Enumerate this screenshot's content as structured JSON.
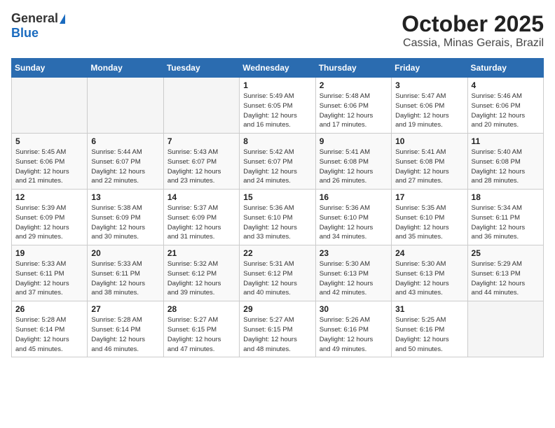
{
  "logo": {
    "general": "General",
    "blue": "Blue"
  },
  "header": {
    "month": "October 2025",
    "location": "Cassia, Minas Gerais, Brazil"
  },
  "weekdays": [
    "Sunday",
    "Monday",
    "Tuesday",
    "Wednesday",
    "Thursday",
    "Friday",
    "Saturday"
  ],
  "weeks": [
    [
      {
        "day": "",
        "info": ""
      },
      {
        "day": "",
        "info": ""
      },
      {
        "day": "",
        "info": ""
      },
      {
        "day": "1",
        "info": "Sunrise: 5:49 AM\nSunset: 6:05 PM\nDaylight: 12 hours\nand 16 minutes."
      },
      {
        "day": "2",
        "info": "Sunrise: 5:48 AM\nSunset: 6:06 PM\nDaylight: 12 hours\nand 17 minutes."
      },
      {
        "day": "3",
        "info": "Sunrise: 5:47 AM\nSunset: 6:06 PM\nDaylight: 12 hours\nand 19 minutes."
      },
      {
        "day": "4",
        "info": "Sunrise: 5:46 AM\nSunset: 6:06 PM\nDaylight: 12 hours\nand 20 minutes."
      }
    ],
    [
      {
        "day": "5",
        "info": "Sunrise: 5:45 AM\nSunset: 6:06 PM\nDaylight: 12 hours\nand 21 minutes."
      },
      {
        "day": "6",
        "info": "Sunrise: 5:44 AM\nSunset: 6:07 PM\nDaylight: 12 hours\nand 22 minutes."
      },
      {
        "day": "7",
        "info": "Sunrise: 5:43 AM\nSunset: 6:07 PM\nDaylight: 12 hours\nand 23 minutes."
      },
      {
        "day": "8",
        "info": "Sunrise: 5:42 AM\nSunset: 6:07 PM\nDaylight: 12 hours\nand 24 minutes."
      },
      {
        "day": "9",
        "info": "Sunrise: 5:41 AM\nSunset: 6:08 PM\nDaylight: 12 hours\nand 26 minutes."
      },
      {
        "day": "10",
        "info": "Sunrise: 5:41 AM\nSunset: 6:08 PM\nDaylight: 12 hours\nand 27 minutes."
      },
      {
        "day": "11",
        "info": "Sunrise: 5:40 AM\nSunset: 6:08 PM\nDaylight: 12 hours\nand 28 minutes."
      }
    ],
    [
      {
        "day": "12",
        "info": "Sunrise: 5:39 AM\nSunset: 6:09 PM\nDaylight: 12 hours\nand 29 minutes."
      },
      {
        "day": "13",
        "info": "Sunrise: 5:38 AM\nSunset: 6:09 PM\nDaylight: 12 hours\nand 30 minutes."
      },
      {
        "day": "14",
        "info": "Sunrise: 5:37 AM\nSunset: 6:09 PM\nDaylight: 12 hours\nand 31 minutes."
      },
      {
        "day": "15",
        "info": "Sunrise: 5:36 AM\nSunset: 6:10 PM\nDaylight: 12 hours\nand 33 minutes."
      },
      {
        "day": "16",
        "info": "Sunrise: 5:36 AM\nSunset: 6:10 PM\nDaylight: 12 hours\nand 34 minutes."
      },
      {
        "day": "17",
        "info": "Sunrise: 5:35 AM\nSunset: 6:10 PM\nDaylight: 12 hours\nand 35 minutes."
      },
      {
        "day": "18",
        "info": "Sunrise: 5:34 AM\nSunset: 6:11 PM\nDaylight: 12 hours\nand 36 minutes."
      }
    ],
    [
      {
        "day": "19",
        "info": "Sunrise: 5:33 AM\nSunset: 6:11 PM\nDaylight: 12 hours\nand 37 minutes."
      },
      {
        "day": "20",
        "info": "Sunrise: 5:33 AM\nSunset: 6:11 PM\nDaylight: 12 hours\nand 38 minutes."
      },
      {
        "day": "21",
        "info": "Sunrise: 5:32 AM\nSunset: 6:12 PM\nDaylight: 12 hours\nand 39 minutes."
      },
      {
        "day": "22",
        "info": "Sunrise: 5:31 AM\nSunset: 6:12 PM\nDaylight: 12 hours\nand 40 minutes."
      },
      {
        "day": "23",
        "info": "Sunrise: 5:30 AM\nSunset: 6:13 PM\nDaylight: 12 hours\nand 42 minutes."
      },
      {
        "day": "24",
        "info": "Sunrise: 5:30 AM\nSunset: 6:13 PM\nDaylight: 12 hours\nand 43 minutes."
      },
      {
        "day": "25",
        "info": "Sunrise: 5:29 AM\nSunset: 6:13 PM\nDaylight: 12 hours\nand 44 minutes."
      }
    ],
    [
      {
        "day": "26",
        "info": "Sunrise: 5:28 AM\nSunset: 6:14 PM\nDaylight: 12 hours\nand 45 minutes."
      },
      {
        "day": "27",
        "info": "Sunrise: 5:28 AM\nSunset: 6:14 PM\nDaylight: 12 hours\nand 46 minutes."
      },
      {
        "day": "28",
        "info": "Sunrise: 5:27 AM\nSunset: 6:15 PM\nDaylight: 12 hours\nand 47 minutes."
      },
      {
        "day": "29",
        "info": "Sunrise: 5:27 AM\nSunset: 6:15 PM\nDaylight: 12 hours\nand 48 minutes."
      },
      {
        "day": "30",
        "info": "Sunrise: 5:26 AM\nSunset: 6:16 PM\nDaylight: 12 hours\nand 49 minutes."
      },
      {
        "day": "31",
        "info": "Sunrise: 5:25 AM\nSunset: 6:16 PM\nDaylight: 12 hours\nand 50 minutes."
      },
      {
        "day": "",
        "info": ""
      }
    ]
  ]
}
